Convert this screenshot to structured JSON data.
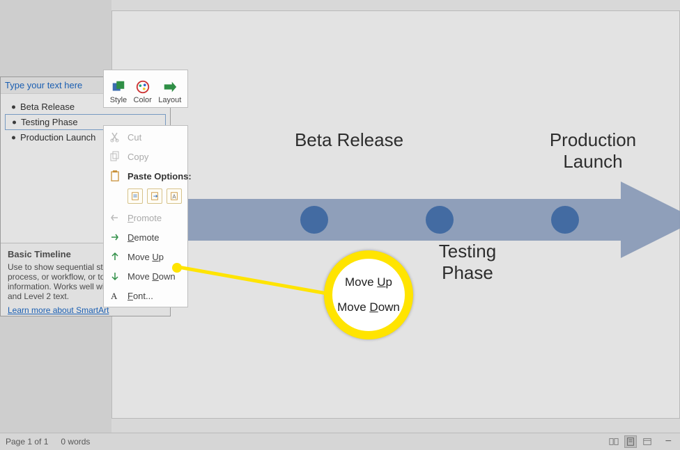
{
  "text_pane": {
    "header": "Type your text here",
    "items": [
      {
        "label": "Beta Release",
        "selected": false
      },
      {
        "label": "Testing Phase",
        "selected": true
      },
      {
        "label": "Production Launch",
        "selected": false
      }
    ],
    "info": {
      "title": "Basic Timeline",
      "desc": "Use to show sequential steps in a task, process, or workflow, or to show timeline information. Works well with both Level 1 and Level 2 text.",
      "link": "Learn more about SmartArt"
    }
  },
  "mini_toolbar": {
    "style": "Style",
    "color": "Color",
    "layout": "Layout"
  },
  "ctx": {
    "cut": "Cut",
    "copy": "Copy",
    "paste_header": "Paste Options:",
    "promote": "Promote",
    "demote": "Demote",
    "move_up": "Move Up",
    "move_down": "Move Down",
    "font": "Font..."
  },
  "timeline": {
    "label_beta": "Beta Release",
    "label_test": "Testing Phase",
    "label_prod": "Production Launch"
  },
  "callout": {
    "up": "Move Up",
    "down": "Move Down"
  },
  "statusbar": {
    "page": "Page 1 of 1",
    "words": "0 words",
    "minus": "−"
  },
  "colors": {
    "arrow_fill": "#8ea4c8",
    "dot_fill": "#3c6db0",
    "highlight": "#ffe400"
  },
  "chart_data": {
    "type": "bar",
    "title": "Basic Timeline",
    "categories": [
      "Beta Release",
      "Testing Phase",
      "Production Launch"
    ],
    "values": [
      1,
      2,
      3
    ],
    "xlabel": "",
    "ylabel": "",
    "ylim": [
      0,
      3
    ]
  }
}
